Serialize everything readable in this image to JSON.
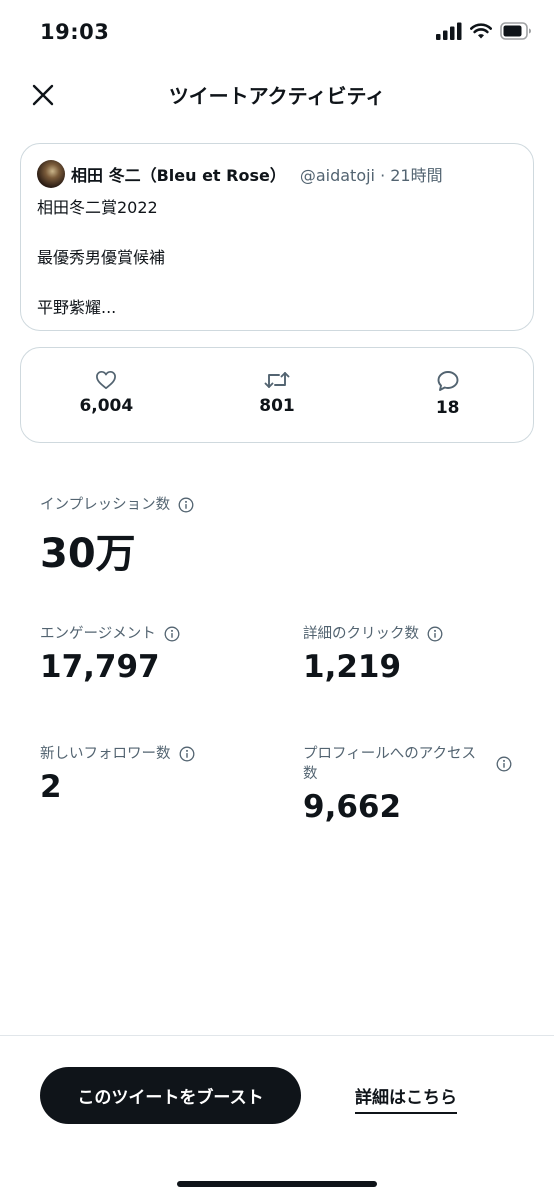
{
  "status_bar": {
    "time": "19:03"
  },
  "header": {
    "title": "ツイートアクティビティ"
  },
  "tweet": {
    "author_name": "相田 冬二（Bleu et Rose）",
    "handle": "@aidatoji · 21時間",
    "lines": [
      "相田冬二賞2022",
      "最優秀男優賞候補",
      "平野紫耀..."
    ]
  },
  "engagement_counts": {
    "likes": "6,004",
    "retweets": "801",
    "replies": "18"
  },
  "metrics": {
    "impressions": {
      "label": "インプレッション数",
      "value": "30万"
    },
    "engagements": {
      "label": "エンゲージメント",
      "value": "17,797"
    },
    "detail_clicks": {
      "label": "詳細のクリック数",
      "value": "1,219"
    },
    "new_followers": {
      "label": "新しいフォロワー数",
      "value": "2"
    },
    "profile_visits": {
      "label": "プロフィールへのアクセス数",
      "value": "9,662"
    }
  },
  "footer": {
    "boost_label": "このツイートをブースト",
    "details_label": "詳細はこちら"
  },
  "icons": [
    "close-icon",
    "heart-icon",
    "retweet-icon",
    "reply-icon",
    "info-icon",
    "signal-icon",
    "wifi-icon",
    "battery-icon"
  ]
}
